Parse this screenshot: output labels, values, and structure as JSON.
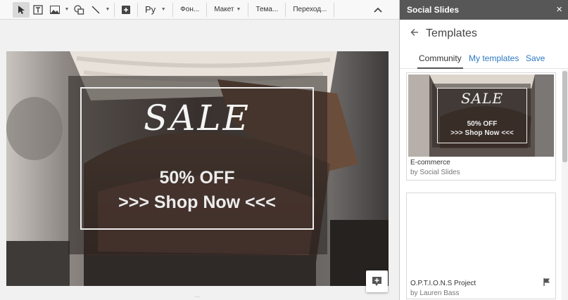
{
  "toolbar": {
    "icons": [
      "select-cursor-icon",
      "text-box-icon",
      "image-icon",
      "shape-icon",
      "line-icon",
      "comment-add-icon"
    ],
    "language": "Ру",
    "background": "Фон...",
    "layout": "Макет",
    "theme": "Тема...",
    "transition": "Переход..."
  },
  "slide": {
    "title": "SALE",
    "discount": "50% OFF",
    "cta": ">>> Shop Now <<<"
  },
  "panel": {
    "app_name": "Social Slides",
    "close": "×",
    "title": "Templates",
    "tabs": {
      "community": "Community",
      "my_templates": "My templates",
      "save": "Save"
    },
    "templates": [
      {
        "name": "E-commerce",
        "author": "by Social Slides",
        "thumb_title": "SALE",
        "thumb_discount": "50% OFF",
        "thumb_cta": ">>> Shop Now <<<"
      },
      {
        "name": "O.P.T.I.O.N.S Project",
        "author": "by Lauren Bass"
      }
    ]
  },
  "colors": {
    "accent_link": "#2d79c4",
    "panel_header": "#575757"
  }
}
